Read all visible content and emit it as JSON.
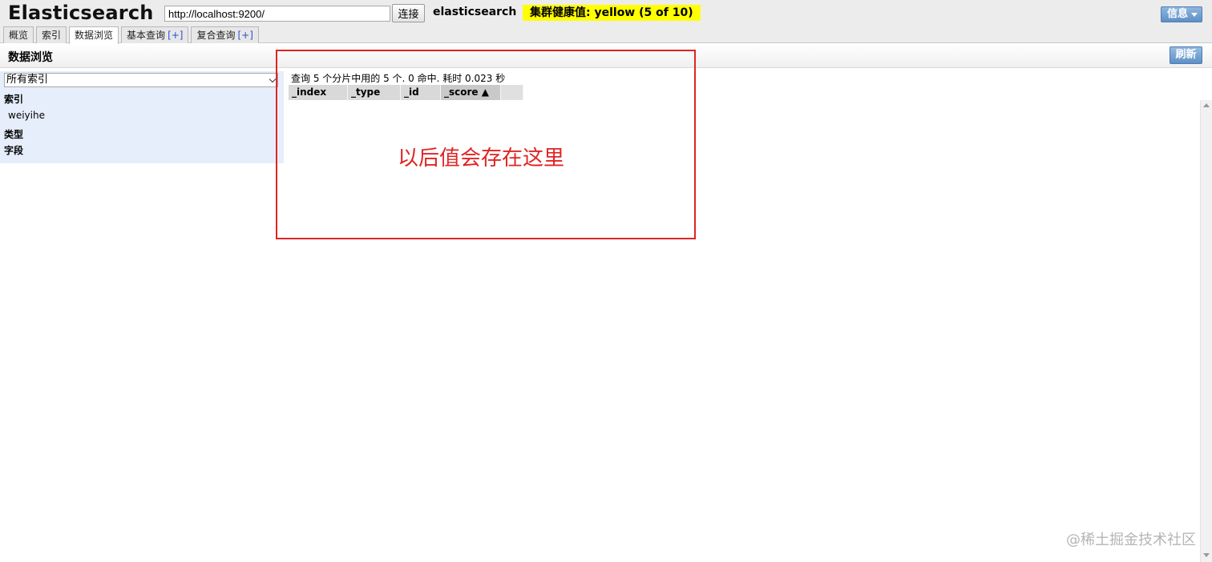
{
  "header": {
    "app_title": "Elasticsearch",
    "url_value": "http://localhost:9200/",
    "connect_label": "连接",
    "cluster_name": "elasticsearch",
    "health_label": "集群健康值: yellow (5 of 10)",
    "info_label": "信息"
  },
  "tabs": [
    {
      "label": "概览",
      "plus": ""
    },
    {
      "label": "索引",
      "plus": ""
    },
    {
      "label": "数据浏览",
      "plus": ""
    },
    {
      "label": "基本查询",
      "plus": "[+]"
    },
    {
      "label": "复合查询",
      "plus": "[+]"
    }
  ],
  "section": {
    "title": "数据浏览",
    "refresh_label": "刷新"
  },
  "sidebar": {
    "index_select_value": "所有索引",
    "indices_heading": "索引",
    "indices": [
      "weiyihe"
    ],
    "types_heading": "类型",
    "fields_heading": "字段"
  },
  "results": {
    "summary": "查询 5 个分片中用的 5 个. 0 命中. 耗时 0.023 秒",
    "columns": [
      "_index",
      "_type",
      "_id",
      "_score ▲"
    ]
  },
  "annotation": {
    "text": "以后值会存在这里",
    "color": "#e02424"
  },
  "watermark": "@稀土掘金技术社区",
  "colors": {
    "health_bg": "#ffff00",
    "accent_button": "#5f90c5",
    "sidebar_bg": "#e6eefc"
  }
}
